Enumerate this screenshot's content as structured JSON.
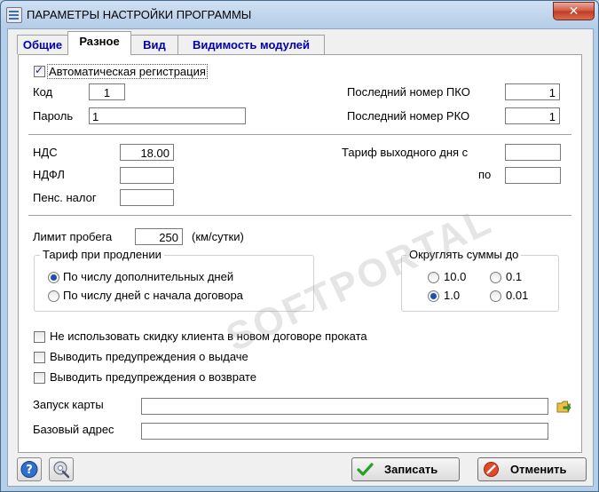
{
  "window": {
    "title": "ПАРАМЕТРЫ НАСТРОЙКИ ПРОГРАММЫ",
    "close_glyph": "✕"
  },
  "tabs": [
    {
      "label": "Общие"
    },
    {
      "label": "Разное"
    },
    {
      "label": "Вид"
    },
    {
      "label": "Видимость модулей"
    }
  ],
  "active_tab": "Разное",
  "auth": {
    "auto_registration": {
      "label": "Автоматическая регистрация",
      "checked": true
    },
    "code": {
      "label": "Код",
      "value": "1"
    },
    "password": {
      "label": "Пароль",
      "value": "1"
    },
    "last_pko": {
      "label": "Последний номер ПКО",
      "value": "1"
    },
    "last_rko": {
      "label": "Последний номер РКО",
      "value": "1"
    }
  },
  "taxes": {
    "vat": {
      "label": "НДС",
      "value": "18.00"
    },
    "ndfl": {
      "label": "НДФЛ",
      "value": ""
    },
    "pension": {
      "label": "Пенс. налог",
      "value": ""
    },
    "weekend_from": {
      "label": "Тариф выходного дня с",
      "value": ""
    },
    "weekend_to": {
      "label": "по",
      "value": ""
    }
  },
  "mileage": {
    "label": "Лимит пробега",
    "value": "250",
    "unit": "(км/сутки)"
  },
  "extension_tariff": {
    "title": "Тариф при продлении",
    "options": [
      {
        "label": "По числу дополнительных дней",
        "selected": true
      },
      {
        "label": "По числу дней с начала договора",
        "selected": false
      }
    ]
  },
  "rounding": {
    "title": "Округлять суммы до",
    "options": [
      {
        "label": "10.0",
        "selected": false
      },
      {
        "label": "0.1",
        "selected": false
      },
      {
        "label": "1.0",
        "selected": true
      },
      {
        "label": "0.01",
        "selected": false
      }
    ]
  },
  "options": [
    {
      "label": "Не использовать скидку клиента в новом договоре проката",
      "checked": false
    },
    {
      "label": "Выводить предупреждения о выдаче",
      "checked": false
    },
    {
      "label": "Выводить предупреждения о возврате",
      "checked": false
    }
  ],
  "paths": {
    "map_launch": {
      "label": "Запуск карты",
      "value": ""
    },
    "base_address": {
      "label": "Базовый адрес",
      "value": ""
    }
  },
  "buttons": {
    "save": "Записать",
    "cancel": "Отменить"
  },
  "icons": {
    "help": "help-icon",
    "settings": "settings-icon",
    "folder": "folder-arrow-icon",
    "save": "check-icon",
    "cancel": "cancel-icon"
  },
  "watermark": {
    "text": "SOFTPORTAL"
  }
}
